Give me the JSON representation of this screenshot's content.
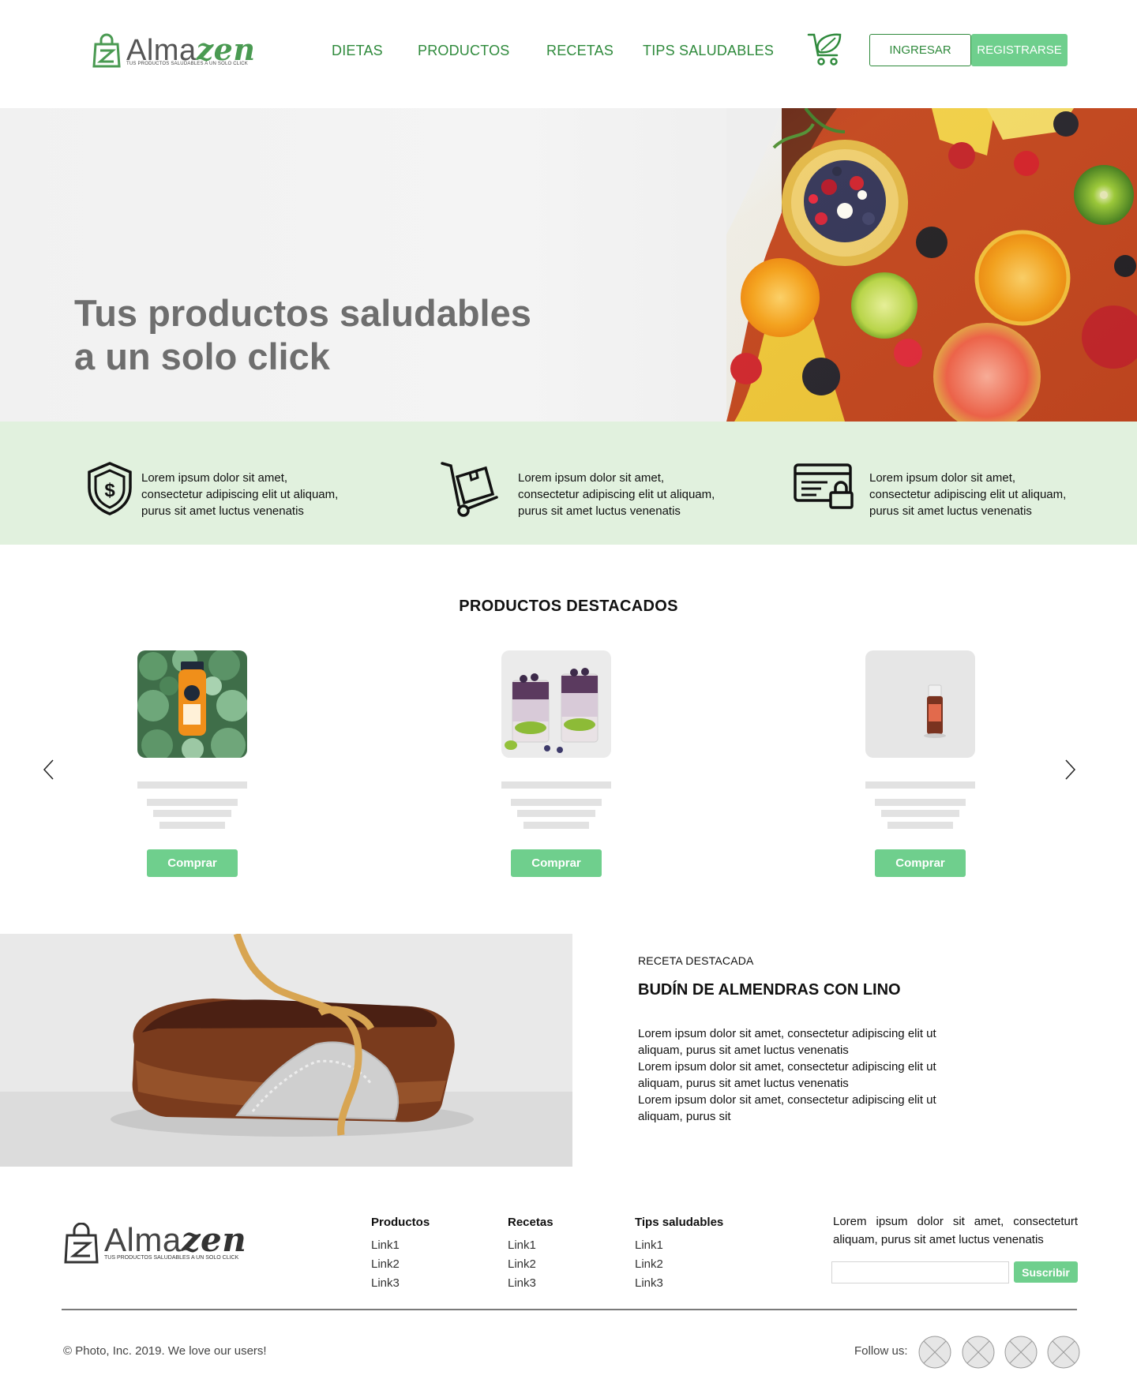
{
  "header": {
    "brand_prefix": "Alma",
    "brand_suffix": "zen",
    "tagline": "TUS PRODUCTOS SALUDABLES A UN SOLO CLICK",
    "nav": [
      "DIETAS",
      "PRODUCTOS",
      "RECETAS",
      "TIPS SALUDABLES"
    ],
    "cart_icon": "leaf-cart-icon",
    "login_label": "INGRESAR",
    "register_label": "REGISTRARSE"
  },
  "hero": {
    "title_line1": "Tus productos saludables",
    "title_line2": "a un solo click"
  },
  "features": [
    {
      "icon": "shield-dollar-icon",
      "line1": "Lorem ipsum dolor sit amet,",
      "line2": "consectetur adipiscing elit ut aliquam,",
      "line3": "purus sit amet luctus venenatis"
    },
    {
      "icon": "hand-truck-icon",
      "line1": "Lorem ipsum dolor sit amet,",
      "line2": "consectetur adipiscing elit ut aliquam,",
      "line3": "purus sit amet luctus venenatis"
    },
    {
      "icon": "secure-card-icon",
      "line1": "Lorem ipsum dolor sit amet,",
      "line2": "consectetur adipiscing elit ut aliquam,",
      "line3": "purus sit amet luctus venenatis"
    }
  ],
  "products_section": {
    "title": "PRODUCTOS DESTACADOS",
    "items": [
      {
        "image": "juice-bottle-image",
        "button": "Comprar"
      },
      {
        "image": "kiwi-parfait-image",
        "button": "Comprar"
      },
      {
        "image": "oil-bottle-image",
        "button": "Comprar"
      }
    ]
  },
  "recipe": {
    "kicker": "RECETA DESTACADA",
    "title": "BUDÍN DE ALMENDRAS CON LINO",
    "lines": [
      "Lorem ipsum dolor sit amet, consectetur adipiscing elit ut",
      "aliquam, purus sit amet luctus venenatis",
      "Lorem ipsum dolor sit amet, consectetur adipiscing elit ut",
      "aliquam, purus sit amet luctus venenatis",
      "Lorem ipsum dolor sit amet, consectetur adipiscing elit ut",
      "aliquam, purus sit"
    ]
  },
  "footer": {
    "brand_prefix": "Alma",
    "brand_suffix": "zen",
    "tagline": "TUS PRODUCTOS SALUDABLES A UN SOLO CLICK",
    "columns": [
      {
        "heading": "Productos",
        "links": [
          "Link1",
          "Link2",
          "Link3"
        ]
      },
      {
        "heading": "Recetas",
        "links": [
          "Link1",
          "Link2",
          "Link3"
        ]
      },
      {
        "heading": "Tips saludables",
        "links": [
          "Link1",
          "Link2",
          "Link3"
        ]
      }
    ],
    "newsletter_text": "Lorem ipsum dolor sit amet, consecteturt aliquam, purus sit amet luctus venenatis",
    "newsletter_input_value": "",
    "subscribe_label": "Suscribir",
    "copyright": "© Photo, Inc. 2019. We love our users!",
    "follow_label": "Follow us:"
  },
  "colors": {
    "brand_green": "#2f8a3c",
    "button_green": "#6fcf8d",
    "feature_band": "#e1f1de",
    "skeleton": "#e2e2e2"
  }
}
